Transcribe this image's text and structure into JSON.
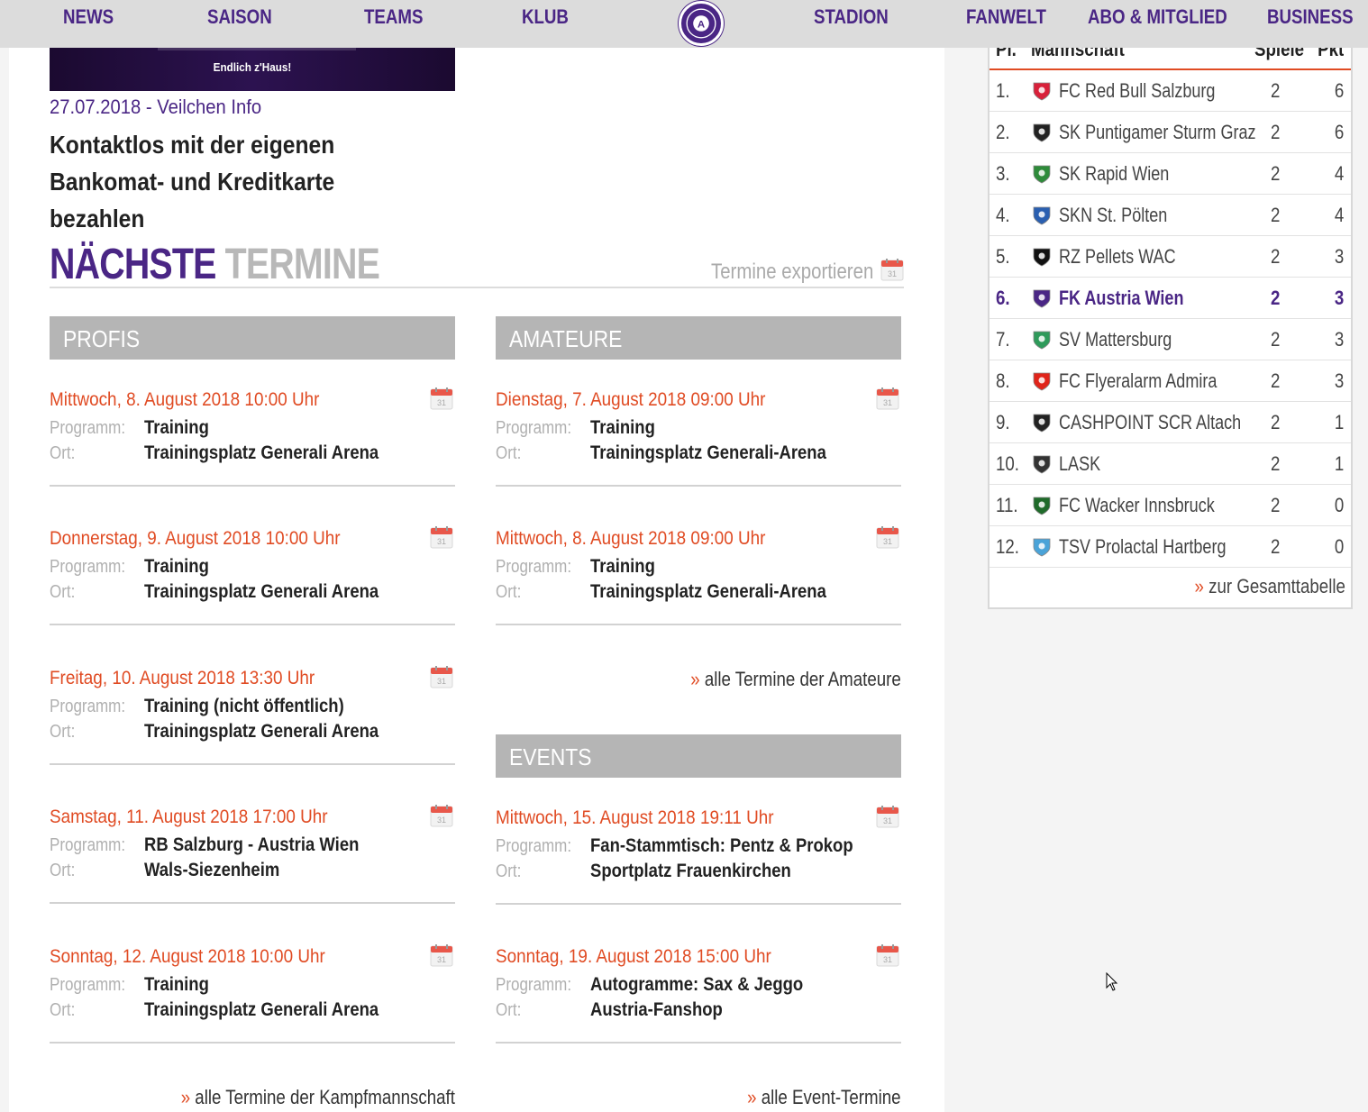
{
  "nav": {
    "items": [
      "NEWS",
      "SAISON",
      "TEAMS",
      "KLUB",
      "STADION",
      "FANWELT",
      "ABO & MITGLIED",
      "BUSINESS"
    ],
    "logo_icon": "club-crest-icon"
  },
  "news": {
    "image_caption": "Endlich z'Haus!",
    "date": "27.07.2018 - Veilchen Info",
    "title_line1": "Kontaktlos mit der eigenen",
    "title_line2": "Bankomat- und Kreditkarte bezahlen"
  },
  "termine": {
    "title_a": "NÄCHSTE",
    "title_b": "TERMINE",
    "export_label": "Termine exportieren",
    "program_label": "Programm:",
    "place_label": "Ort:",
    "profis": {
      "heading": "PROFIS",
      "events": [
        {
          "date": "Mittwoch, 8. August 2018 10:00 Uhr",
          "program": "Training",
          "place": "Trainingsplatz Generali Arena"
        },
        {
          "date": "Donnerstag, 9. August 2018 10:00 Uhr",
          "program": "Training",
          "place": "Trainingsplatz Generali Arena"
        },
        {
          "date": "Freitag, 10. August 2018 13:30 Uhr",
          "program": "Training (nicht öffentlich)",
          "place": "Trainingsplatz Generali Arena"
        },
        {
          "date": "Samstag, 11. August 2018 17:00 Uhr",
          "program": "RB Salzburg - Austria Wien",
          "place": "Wals-Siezenheim"
        },
        {
          "date": "Sonntag, 12. August 2018 10:00 Uhr",
          "program": "Training",
          "place": "Trainingsplatz Generali Arena"
        }
      ],
      "more": "alle Termine der Kampfmannschaft"
    },
    "amateure": {
      "heading": "AMATEURE",
      "events": [
        {
          "date": "Dienstag, 7. August 2018 09:00 Uhr",
          "program": "Training",
          "place": "Trainingsplatz Generali-Arena"
        },
        {
          "date": "Mittwoch, 8. August 2018 09:00 Uhr",
          "program": "Training",
          "place": "Trainingsplatz Generali-Arena"
        }
      ],
      "more": "alle Termine der Amateure"
    },
    "events": {
      "heading": "EVENTS",
      "events": [
        {
          "date": "Mittwoch, 15. August 2018 19:11 Uhr",
          "program": "Fan-Stammtisch: Pentz & Prokop",
          "place": "Sportplatz Frauenkirchen"
        },
        {
          "date": "Sonntag, 19. August 2018 15:00 Uhr",
          "program": "Autogramme: Sax & Jeggo",
          "place": "Austria-Fanshop"
        }
      ],
      "more": "alle Event-Termine"
    },
    "arrow": "»"
  },
  "table": {
    "headers": {
      "pos": "Pl.",
      "team": "Mannschaft",
      "played": "Spiele",
      "points": "Pkt"
    },
    "rows": [
      {
        "pos": "1.",
        "team": "FC Red Bull Salzburg",
        "played": "2",
        "points": "6",
        "color": "#d8203a"
      },
      {
        "pos": "2.",
        "team": "SK Puntigamer Sturm Graz",
        "played": "2",
        "points": "6",
        "color": "#222222"
      },
      {
        "pos": "3.",
        "team": "SK Rapid Wien",
        "played": "2",
        "points": "4",
        "color": "#2e8b3a"
      },
      {
        "pos": "4.",
        "team": "SKN St. Pölten",
        "played": "2",
        "points": "4",
        "color": "#2a5fb0"
      },
      {
        "pos": "5.",
        "team": "RZ Pellets WAC",
        "played": "2",
        "points": "3",
        "color": "#111111"
      },
      {
        "pos": "6.",
        "team": "FK Austria Wien",
        "played": "2",
        "points": "3",
        "color": "#4a2685",
        "highlight": true
      },
      {
        "pos": "7.",
        "team": "SV Mattersburg",
        "played": "2",
        "points": "3",
        "color": "#2e9a5a"
      },
      {
        "pos": "8.",
        "team": "FC Flyeralarm Admira",
        "played": "2",
        "points": "3",
        "color": "#e0241a"
      },
      {
        "pos": "9.",
        "team": "CASHPOINT SCR Altach",
        "played": "2",
        "points": "1",
        "color": "#222222"
      },
      {
        "pos": "10.",
        "team": "LASK",
        "played": "2",
        "points": "1",
        "color": "#333333"
      },
      {
        "pos": "11.",
        "team": "FC Wacker Innsbruck",
        "played": "2",
        "points": "0",
        "color": "#1f6b2a"
      },
      {
        "pos": "12.",
        "team": "TSV Prolactal Hartberg",
        "played": "2",
        "points": "0",
        "color": "#4aa3d8"
      }
    ],
    "more": "zur Gesamttabelle"
  },
  "colors": {
    "brand": "#4a2685",
    "accent": "#e04b23",
    "section_header": "#b5b5b5"
  }
}
